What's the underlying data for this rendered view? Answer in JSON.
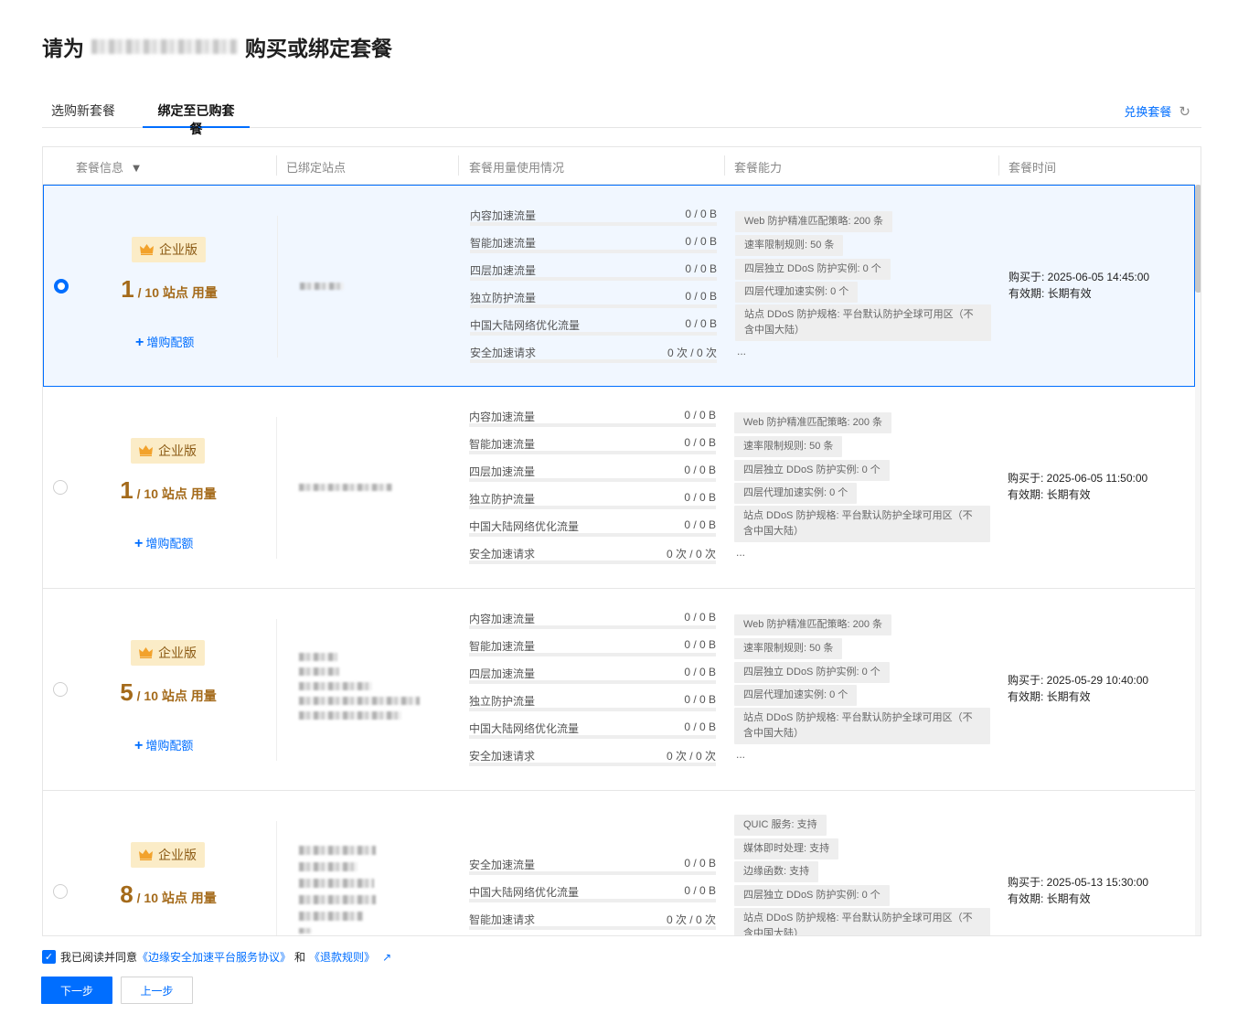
{
  "page": {
    "title_prefix": "请为",
    "title_suffix": "购买或绑定套餐"
  },
  "tabs": [
    {
      "label": "选购新套餐",
      "active": false
    },
    {
      "label": "绑定至已购套餐",
      "active": true
    }
  ],
  "redeem": {
    "label": "兑换套餐",
    "icon": "refresh-icon"
  },
  "table": {
    "headers": [
      "套餐信息",
      "已绑定站点",
      "套餐用量使用情况",
      "套餐能力",
      "套餐时间"
    ],
    "filter_icon": "filter-icon",
    "rows": [
      {
        "selected": true,
        "edition": "企业版",
        "usage_used": "1",
        "usage_rest": "/ 10 站点 用量",
        "add_quota": "增购配额",
        "metrics": [
          {
            "label": "内容加速流量",
            "value": "0 / 0 B"
          },
          {
            "label": "智能加速流量",
            "value": "0 / 0 B"
          },
          {
            "label": "四层加速流量",
            "value": "0 / 0 B"
          },
          {
            "label": "独立防护流量",
            "value": "0 / 0 B"
          },
          {
            "label": "中国大陆网络优化流量",
            "value": "0 / 0 B"
          },
          {
            "label": "安全加速请求",
            "value": "0 次 / 0 次"
          }
        ],
        "capabilities": [
          "Web 防护精准匹配策略: 200 条",
          "速率限制规则: 50 条",
          "四层独立 DDoS 防护实例: 0 个",
          "四层代理加速实例: 0 个",
          "站点 DDoS 防护规格: 平台默认防护全球可用区（不含中国大陆）"
        ],
        "more": "...",
        "purchase": "购买于:  2025-06-05 14:45:00",
        "validity": "有效期:  长期有效"
      },
      {
        "selected": false,
        "edition": "企业版",
        "usage_used": "1",
        "usage_rest": "/ 10 站点 用量",
        "add_quota": "增购配额",
        "metrics": [
          {
            "label": "内容加速流量",
            "value": "0 / 0 B"
          },
          {
            "label": "智能加速流量",
            "value": "0 / 0 B"
          },
          {
            "label": "四层加速流量",
            "value": "0 / 0 B"
          },
          {
            "label": "独立防护流量",
            "value": "0 / 0 B"
          },
          {
            "label": "中国大陆网络优化流量",
            "value": "0 / 0 B"
          },
          {
            "label": "安全加速请求",
            "value": "0 次 / 0 次"
          }
        ],
        "capabilities": [
          "Web 防护精准匹配策略: 200 条",
          "速率限制规则: 50 条",
          "四层独立 DDoS 防护实例: 0 个",
          "四层代理加速实例: 0 个",
          "站点 DDoS 防护规格: 平台默认防护全球可用区（不含中国大陆）"
        ],
        "more": "...",
        "purchase": "购买于:  2025-06-05 11:50:00",
        "validity": "有效期:  长期有效"
      },
      {
        "selected": false,
        "edition": "企业版",
        "usage_used": "5",
        "usage_rest": "/ 10 站点 用量",
        "add_quota": "增购配额",
        "metrics": [
          {
            "label": "内容加速流量",
            "value": "0 / 0 B"
          },
          {
            "label": "智能加速流量",
            "value": "0 / 0 B"
          },
          {
            "label": "四层加速流量",
            "value": "0 / 0 B"
          },
          {
            "label": "独立防护流量",
            "value": "0 / 0 B"
          },
          {
            "label": "中国大陆网络优化流量",
            "value": "0 / 0 B"
          },
          {
            "label": "安全加速请求",
            "value": "0 次 / 0 次"
          }
        ],
        "capabilities": [
          "Web 防护精准匹配策略: 200 条",
          "速率限制规则: 50 条",
          "四层独立 DDoS 防护实例: 0 个",
          "四层代理加速实例: 0 个",
          "站点 DDoS 防护规格: 平台默认防护全球可用区（不含中国大陆）"
        ],
        "more": "...",
        "purchase": "购买于:  2025-05-29 10:40:00",
        "validity": "有效期:  长期有效"
      },
      {
        "selected": false,
        "edition": "企业版",
        "usage_used": "8",
        "usage_rest": "/ 10 站点 用量",
        "add_quota": "增购配额",
        "metrics": [
          {
            "label": "安全加速流量",
            "value": "0 / 0 B"
          },
          {
            "label": "中国大陆网络优化流量",
            "value": "0 / 0 B"
          },
          {
            "label": "智能加速请求",
            "value": "0 次 / 0 次"
          }
        ],
        "capabilities": [
          "QUIC 服务: 支持",
          "媒体即时处理: 支持",
          "边缘函数: 支持",
          "四层独立 DDoS 防护实例: 0 个",
          "站点 DDoS 防护规格: 平台默认防护全球可用区（不含中国大陆）"
        ],
        "more": "",
        "purchase": "购买于:  2025-05-13 15:30:00",
        "validity": "有效期:  长期有效"
      }
    ]
  },
  "agreement": {
    "checked": true,
    "prefix": "我已阅读并同意",
    "service_link": "《边缘安全加速平台服务协议》",
    "and": "和",
    "refund_link": "《退款规则》"
  },
  "buttons": {
    "next": "下一步",
    "prev": "上一步"
  },
  "colors": {
    "primary": "#006eff",
    "badge_bg": "#fbecc7",
    "badge_text": "#8b5a14",
    "usage": "#a46a1a"
  }
}
